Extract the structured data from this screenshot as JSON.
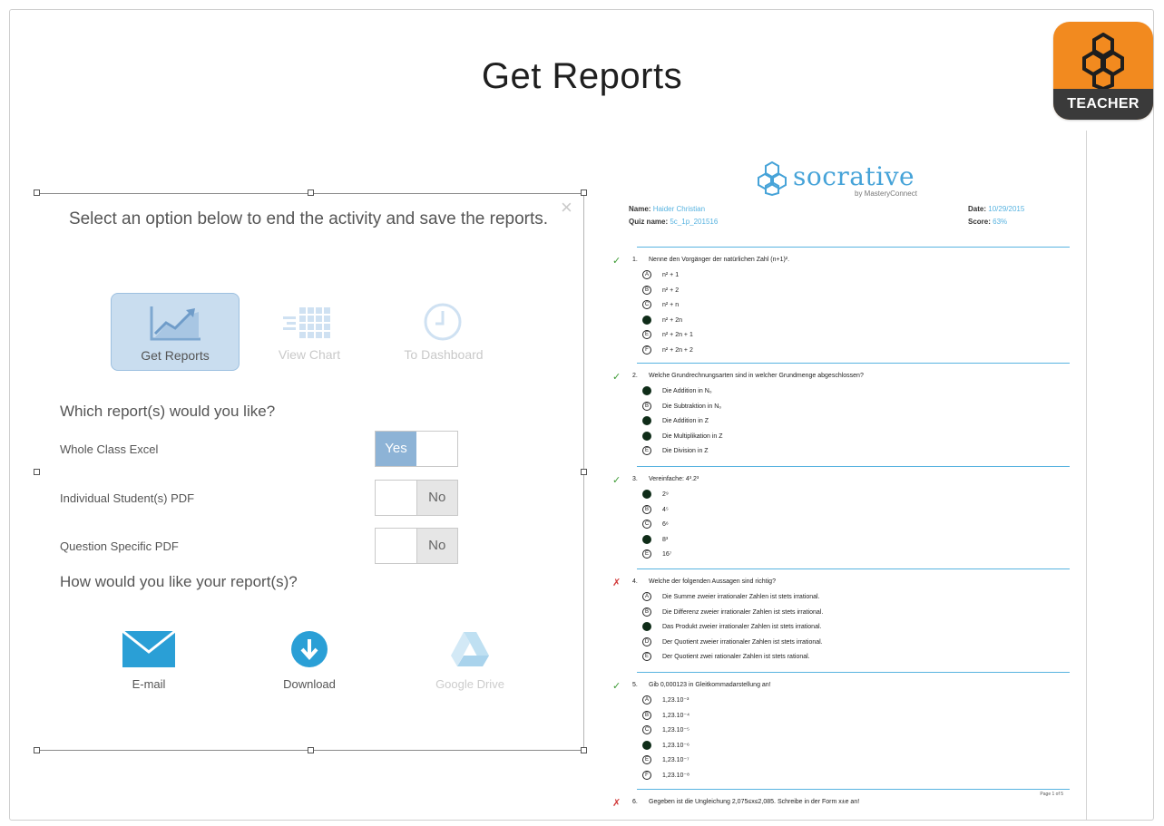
{
  "slide": {
    "title": "Get Reports"
  },
  "badge": {
    "label": "TEACHER",
    "accent": "#f28a1f"
  },
  "dialog": {
    "prompt": "Select an option below to end the activity and save the reports.",
    "options": [
      {
        "label": "Get Reports",
        "icon": "line-chart-icon",
        "selected": true
      },
      {
        "label": "View Chart",
        "icon": "grid-chart-icon",
        "selected": false
      },
      {
        "label": "To Dashboard",
        "icon": "clock-icon",
        "selected": false
      }
    ],
    "which_heading": "Which report(s) would you like?",
    "report_rows": [
      {
        "label": "Whole Class Excel",
        "value": "Yes"
      },
      {
        "label": "Individual Student(s) PDF",
        "value": "No"
      },
      {
        "label": "Question Specific PDF",
        "value": "No"
      }
    ],
    "how_heading": "How would you like your report(s)?",
    "delivery": [
      {
        "label": "E-mail",
        "icon": "envelope-icon"
      },
      {
        "label": "Download",
        "icon": "download-icon"
      },
      {
        "label": "Google Drive",
        "icon": "google-drive-icon"
      }
    ],
    "colors": {
      "selected_bg": "#c9ddef",
      "toggle_on": "#8db3d6",
      "icon_blue": "#2a9fd6"
    }
  },
  "report": {
    "brand": "socrative",
    "brand_sub": "by MasteryConnect",
    "name_label": "Name:",
    "name_value": "Haider Christian",
    "quiz_label": "Quiz name:",
    "quiz_value": "5c_1p_201516",
    "date_label": "Date:",
    "date_value": "10/29/2015",
    "score_label": "Score:",
    "score_value": "63%",
    "questions": [
      {
        "number": "1.",
        "correct": true,
        "text": "Nenne den Vorgänger der natürlichen Zahl (n+1)².",
        "answers": [
          {
            "letter": "A",
            "text": "n² + 1",
            "selected": false
          },
          {
            "letter": "B",
            "text": "n² + 2",
            "selected": false
          },
          {
            "letter": "C",
            "text": "n² + n",
            "selected": false
          },
          {
            "letter": "D",
            "text": "n² + 2n",
            "selected": true
          },
          {
            "letter": "E",
            "text": "n² + 2n + 1",
            "selected": false
          },
          {
            "letter": "F",
            "text": "n² + 2n + 2",
            "selected": false
          }
        ]
      },
      {
        "number": "2.",
        "correct": true,
        "text": "Welche Grundrechnungsarten sind in welcher Grundmenge abgeschlossen?",
        "answers": [
          {
            "letter": "A",
            "text": "Die Addition in N₀",
            "selected": true
          },
          {
            "letter": "B",
            "text": "Die Subtraktion in N₀",
            "selected": false
          },
          {
            "letter": "C",
            "text": "Die Addition in Z",
            "selected": true
          },
          {
            "letter": "D",
            "text": "Die Multiplikation in Z",
            "selected": true
          },
          {
            "letter": "E",
            "text": "Die Division in Z",
            "selected": false
          }
        ]
      },
      {
        "number": "3.",
        "correct": true,
        "text": "Vereinfache: 4³.2³",
        "answers": [
          {
            "letter": "A",
            "text": "2⁹",
            "selected": true
          },
          {
            "letter": "B",
            "text": "4⁵",
            "selected": false
          },
          {
            "letter": "C",
            "text": "6⁶",
            "selected": false
          },
          {
            "letter": "D",
            "text": "8³",
            "selected": true
          },
          {
            "letter": "E",
            "text": "16⁷",
            "selected": false
          }
        ]
      },
      {
        "number": "4.",
        "correct": false,
        "text": "Welche der folgenden Aussagen sind richtig?",
        "answers": [
          {
            "letter": "A",
            "text": "Die Summe zweier irrationaler Zahlen ist stets irrational.",
            "selected": false
          },
          {
            "letter": "B",
            "text": "Die Differenz zweier irrationaler Zahlen ist stets irrational.",
            "selected": false
          },
          {
            "letter": "C",
            "text": "Das Produkt zweier irrationaler Zahlen ist stets irrational.",
            "selected": true
          },
          {
            "letter": "D",
            "text": "Der Quotient zweier irrationaler Zahlen ist stets irrational.",
            "selected": false
          },
          {
            "letter": "E",
            "text": "Der Quotient zwei rationaler Zahlen ist stets rational.",
            "selected": false
          }
        ]
      },
      {
        "number": "5.",
        "correct": true,
        "text": "Gib 0,000123 in Gleitkommadarstellung an!",
        "answers": [
          {
            "letter": "A",
            "text": "1,23.10⁻³",
            "selected": false
          },
          {
            "letter": "B",
            "text": "1,23.10⁻⁴",
            "selected": false
          },
          {
            "letter": "C",
            "text": "1,23.10⁻⁵",
            "selected": false
          },
          {
            "letter": "D",
            "text": "1,23.10⁻⁶",
            "selected": true
          },
          {
            "letter": "E",
            "text": "1,23.10⁻⁷",
            "selected": false
          },
          {
            "letter": "F",
            "text": "1,23.10⁻⁸",
            "selected": false
          }
        ]
      },
      {
        "number": "6.",
        "correct": false,
        "text": "Gegeben ist die Ungleichung 2,075≤x≤2,085. Schreibe in der Form x±e an!",
        "answers": []
      }
    ],
    "footer": "Page 1 of 5"
  }
}
